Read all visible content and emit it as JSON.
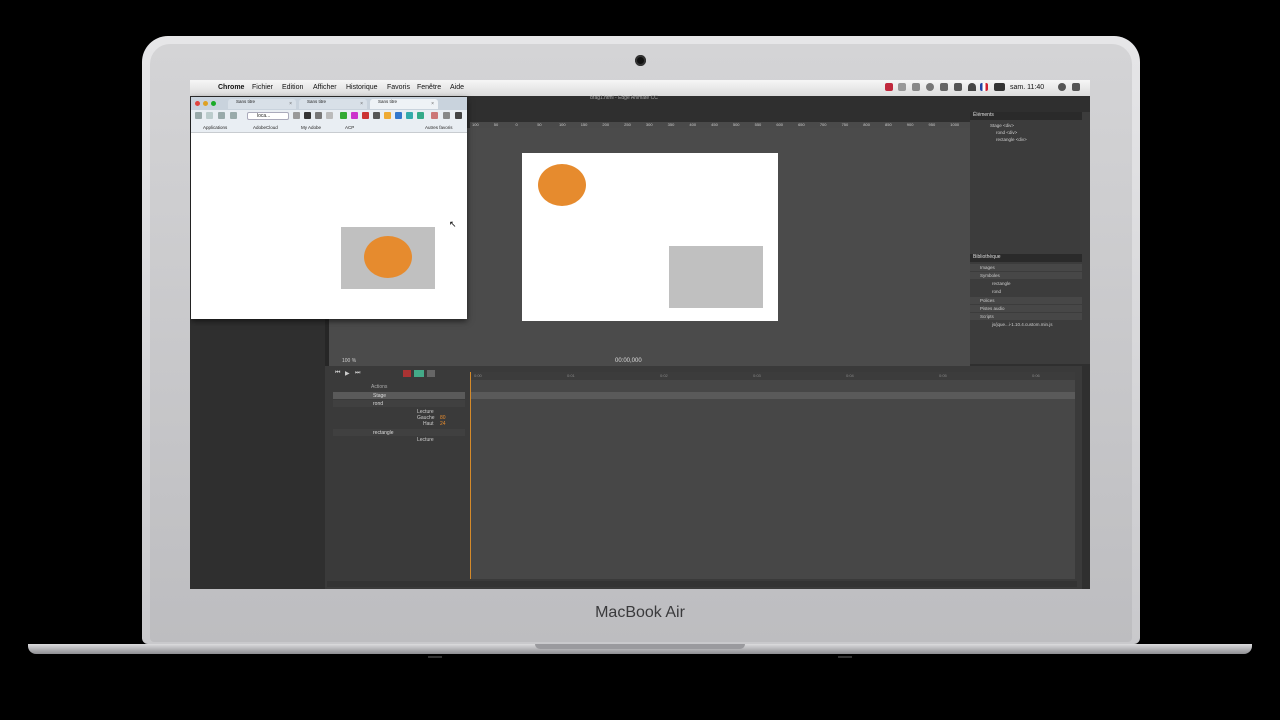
{
  "device": {
    "brand": "MacBook Air"
  },
  "menubar": {
    "apple": "",
    "app": "Chrome",
    "items": [
      "Fichier",
      "Edition",
      "Afficher",
      "Historique",
      "Favoris",
      "Fenêtre",
      "Aide"
    ],
    "clock": "sam. 11:40"
  },
  "chrome": {
    "tabs": [
      "Sans titre",
      "Sans titre",
      "Sans titre"
    ],
    "url": "loca...",
    "bookmarks": [
      "Applications",
      "AdobeCloud",
      "My Adobe",
      "ACP",
      "Autres favoris"
    ]
  },
  "animate": {
    "window_title": "drag1.html - Edge Animate CC",
    "ruler_ticks": [
      "100",
      "50",
      "0",
      "50",
      "100",
      "150",
      "200",
      "250",
      "300",
      "350",
      "400",
      "450",
      "500",
      "550",
      "600",
      "650",
      "700",
      "750",
      "800",
      "850",
      "900",
      "950",
      "1000"
    ],
    "zoom": "100 %",
    "time": "00:00,000",
    "elements_panel": {
      "title": "Éléments",
      "items": [
        "Stage <div>",
        "rond <div>",
        "rectangle <div>"
      ]
    },
    "library_panel": {
      "title": "Bibliothèque",
      "sections": [
        "Images",
        "Symboles",
        "Polices",
        "Pistes audio",
        "Scripts"
      ],
      "symbols": [
        "rectangle",
        "rond"
      ],
      "scripts": [
        "js/jque...i-1.10.4.custom.min.js"
      ]
    },
    "timeline": {
      "actions_label": "Actions",
      "layers": [
        "Stage",
        "rond",
        "rectangle"
      ],
      "rond_props": [
        "Lecture",
        "Gauche",
        "Haut"
      ],
      "rond_values": [
        "",
        "80",
        "24"
      ],
      "rectangle_props": [
        "Lecture"
      ],
      "ruler": [
        "0:00",
        "0:01",
        "0:02",
        "0:03",
        "0:04",
        "0:05",
        "0:06"
      ]
    }
  },
  "colors": {
    "circle": "#e68b2e",
    "rect": "#c0c0c0"
  }
}
